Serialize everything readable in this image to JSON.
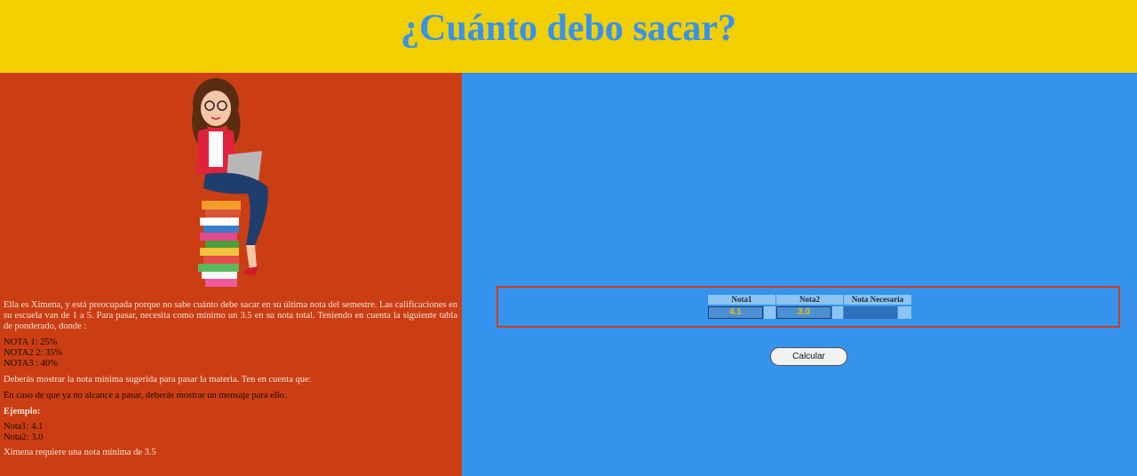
{
  "header": {
    "title": "¿Cuánto debo sacar?"
  },
  "left": {
    "intro": "Ella es Ximena, y está preocupada porque no sabe cuánto debe sacar en su última nota del semestre. Las calificaciones en su escuela van de 1 a 5. Para pasar, necesita como mínimo un 3.5 en su nota total. Teniendo en cuenta la siguiente tabla de ponderado, donde :",
    "weights": [
      "NOTA 1: 25%",
      "NOTA2 2: 35%",
      "NOTA3 : 40%"
    ],
    "instruction": "Deberás mostrar la nota mínima sugerida para pasar la materia. Ten en cuenta que:",
    "warning": "En caso de que ya no alcance a pasar, deberás mostrar un mensaje para ello.",
    "example_title": "Ejemplo:",
    "example_lines": [
      "Nota1: 4.1",
      "Nota2: 3.0"
    ],
    "result": "Ximena requiere una nota mínima de 3.5"
  },
  "table": {
    "headers": [
      "Nota1",
      "Nota2",
      "Nota Necesaria"
    ],
    "nota1_value": "4.1",
    "nota2_value": "3.0",
    "necesaria_value": ""
  },
  "button": {
    "label": "Calcular"
  }
}
